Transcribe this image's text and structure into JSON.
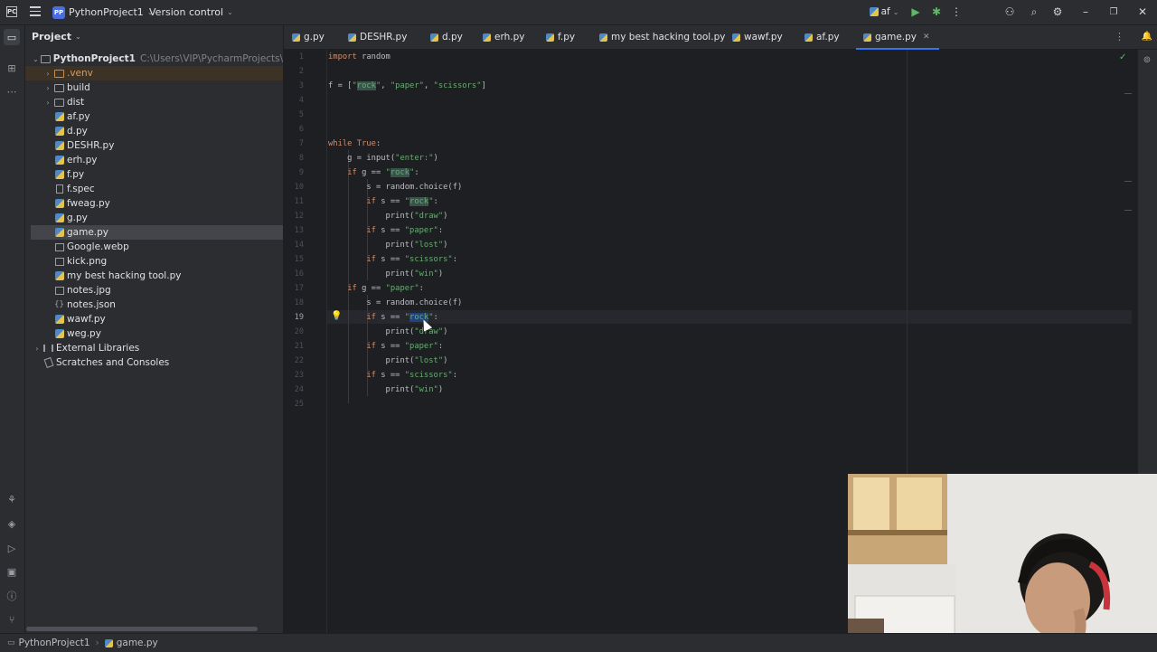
{
  "titlebar": {
    "logo": "PC",
    "project_badge": "PP",
    "project_name": "PythonProject1",
    "version_control": "Version control",
    "run_config": "af"
  },
  "project_panel": {
    "title": "Project",
    "root_name": "PythonProject1",
    "root_path": "C:\\Users\\VIP\\PycharmProjects\\PythonPro",
    "items": [
      {
        "label": ".venv",
        "type": "folder",
        "expanded": false,
        "excluded": true
      },
      {
        "label": "build",
        "type": "folder",
        "expanded": false
      },
      {
        "label": "dist",
        "type": "folder",
        "expanded": false
      },
      {
        "label": "af.py",
        "type": "python"
      },
      {
        "label": "d.py",
        "type": "python"
      },
      {
        "label": "DESHR.py",
        "type": "python"
      },
      {
        "label": "erh.py",
        "type": "python"
      },
      {
        "label": "f.py",
        "type": "python"
      },
      {
        "label": "f.spec",
        "type": "file"
      },
      {
        "label": "fweag.py",
        "type": "python"
      },
      {
        "label": "g.py",
        "type": "python"
      },
      {
        "label": "game.py",
        "type": "python",
        "selected": true
      },
      {
        "label": "Google.webp",
        "type": "image"
      },
      {
        "label": "kick.png",
        "type": "image"
      },
      {
        "label": "my best hacking tool.py",
        "type": "python"
      },
      {
        "label": "notes.jpg",
        "type": "image"
      },
      {
        "label": "notes.json",
        "type": "json"
      },
      {
        "label": "wawf.py",
        "type": "python"
      },
      {
        "label": "weg.py",
        "type": "python"
      }
    ],
    "external_libraries": "External Libraries",
    "scratches": "Scratches and Consoles"
  },
  "tabs": [
    {
      "label": "g.py"
    },
    {
      "label": "DESHR.py"
    },
    {
      "label": "d.py"
    },
    {
      "label": "erh.py"
    },
    {
      "label": "f.py"
    },
    {
      "label": "my best hacking tool.py"
    },
    {
      "label": "wawf.py"
    },
    {
      "label": "af.py"
    },
    {
      "label": "game.py",
      "active": true
    }
  ],
  "editor": {
    "current_line": "19",
    "line_numbers": [
      "1",
      "2",
      "3",
      "4",
      "5",
      "6",
      "7",
      "8",
      "9",
      "10",
      "11",
      "12",
      "13",
      "14",
      "15",
      "16",
      "17",
      "18",
      "19",
      "20",
      "21",
      "22",
      "23",
      "24",
      "25"
    ]
  },
  "statusbar": {
    "project": "PythonProject1",
    "file": "game.py"
  },
  "colors": {
    "accent": "#3574f0",
    "keyword": "#cf8e6d",
    "string": "#6aab73",
    "background": "#1e1f22",
    "panel": "#2b2d30"
  }
}
